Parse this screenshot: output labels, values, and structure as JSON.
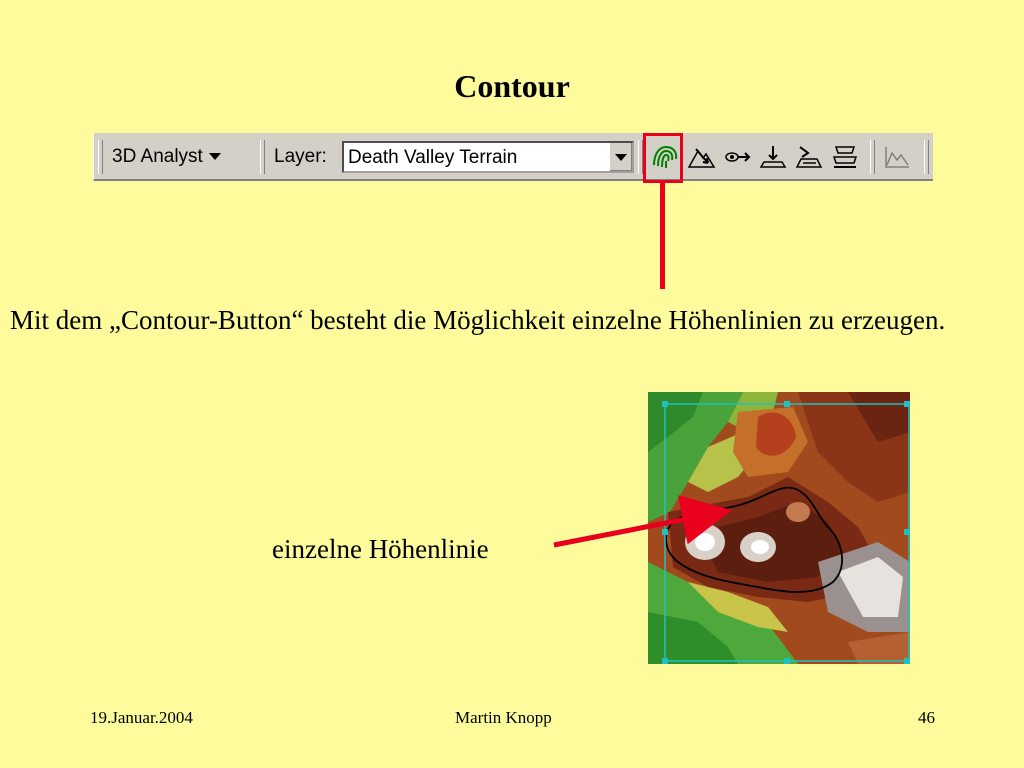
{
  "slide": {
    "title": "Contour",
    "description": "Mit dem „Contour-Button“ besteht die Möglichkeit einzelne Höhenlinien zu erzeugen.",
    "callout_label": "einzelne Höhenlinie"
  },
  "toolbar": {
    "menu_label": "3D Analyst",
    "layer_label": "Layer:",
    "layer_value": "Death Valley Terrain",
    "buttons": [
      {
        "name": "contour-icon",
        "highlighted": true
      },
      {
        "name": "steepest-path-icon"
      },
      {
        "name": "line-of-sight-icon"
      },
      {
        "name": "interpolate-point-icon"
      },
      {
        "name": "interpolate-line-icon"
      },
      {
        "name": "interpolate-polygon-icon"
      },
      {
        "name": "create-profile-graph-icon"
      }
    ]
  },
  "footer": {
    "date": "19.Januar.2004",
    "author": "Martin Knopp",
    "page": "46"
  },
  "colors": {
    "background": "#fdfb9c",
    "highlight_red": "#e8001c"
  }
}
